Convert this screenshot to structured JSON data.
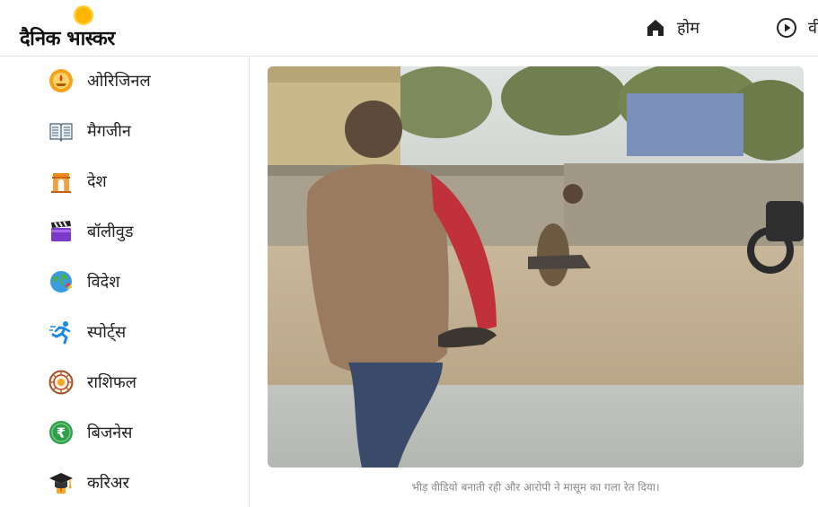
{
  "header": {
    "logo_text": "दैनिक भास्कर",
    "nav": [
      {
        "label": "होम",
        "icon": "home-icon"
      },
      {
        "label": "वी",
        "icon": "play-circle-icon"
      }
    ]
  },
  "sidebar": {
    "items": [
      {
        "label": "ओरिजिनल",
        "icon": "original-lamp-icon"
      },
      {
        "label": "मैगजीन",
        "icon": "magazine-icon"
      },
      {
        "label": "देश",
        "icon": "india-gate-icon"
      },
      {
        "label": "बॉलीवुड",
        "icon": "clapperboard-icon"
      },
      {
        "label": "विदेश",
        "icon": "globe-icon"
      },
      {
        "label": "स्पोर्ट्स",
        "icon": "runner-icon"
      },
      {
        "label": "राशिफल",
        "icon": "zodiac-wheel-icon"
      },
      {
        "label": "बिजनेस",
        "icon": "rupee-coin-icon"
      },
      {
        "label": "करिअर",
        "icon": "graduation-cap-icon"
      }
    ]
  },
  "article": {
    "image_caption": "भीड़ वीडियो बनाती रही और आरोपी ने मासूम का गला रेत दिया।"
  }
}
